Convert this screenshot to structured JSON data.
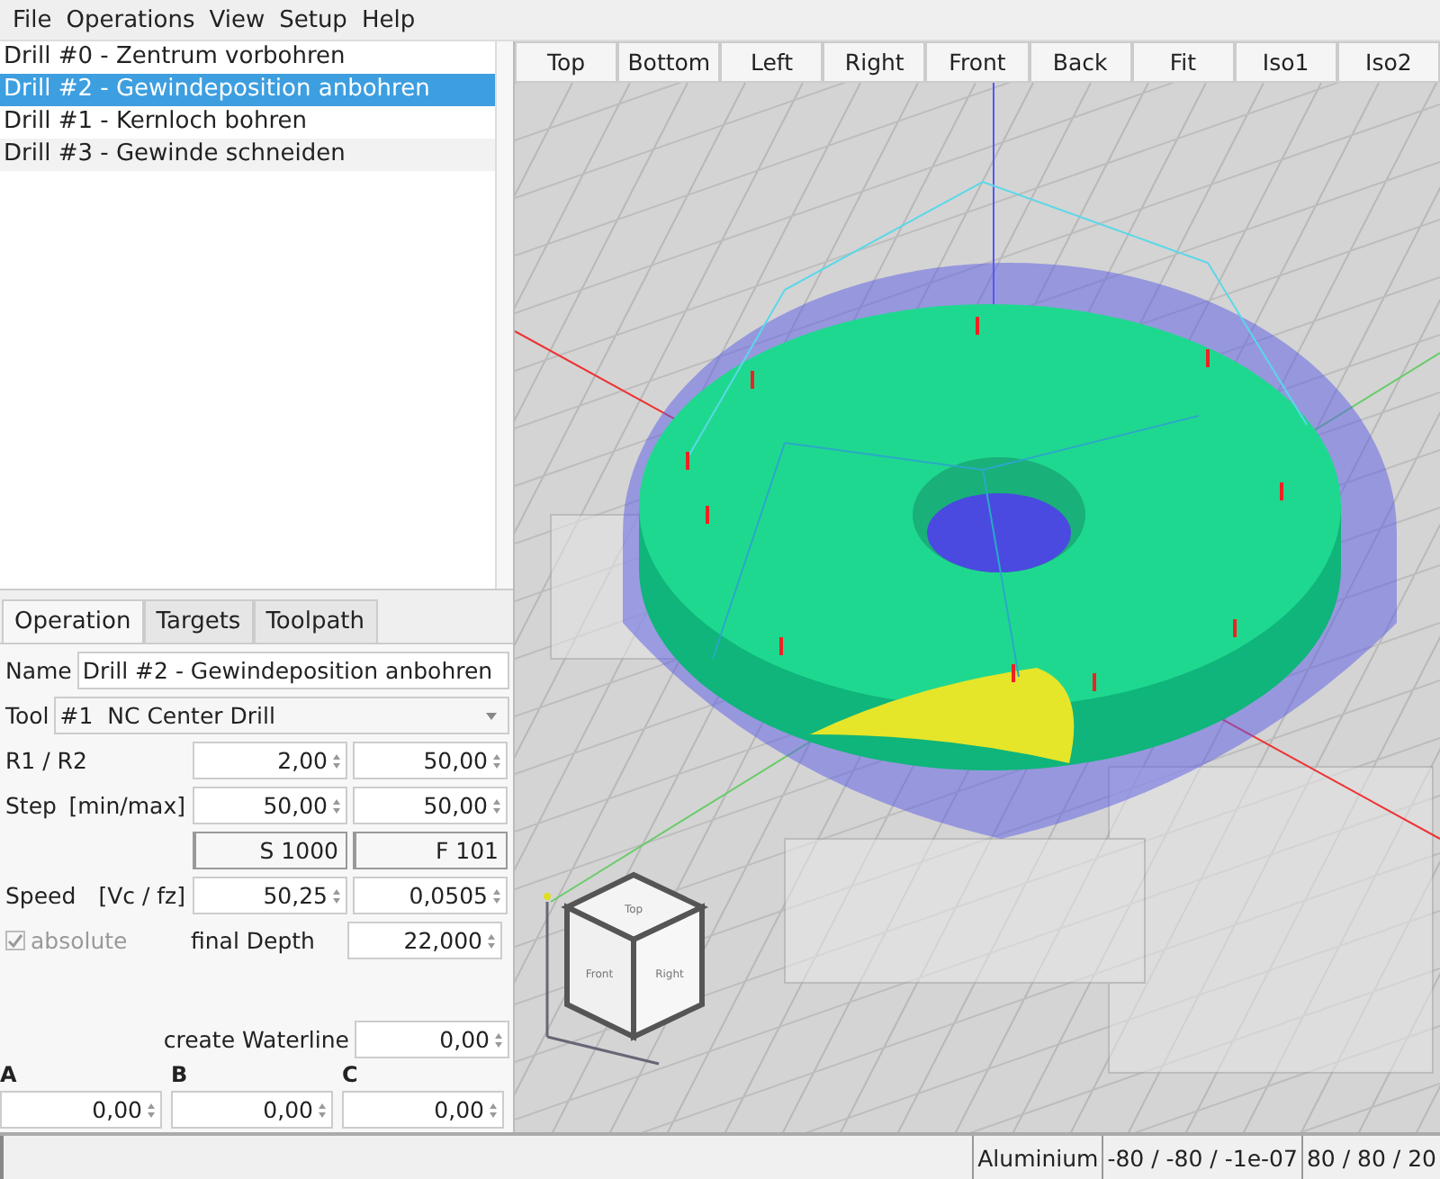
{
  "menu": [
    "File",
    "Operations",
    "View",
    "Setup",
    "Help"
  ],
  "operations": [
    {
      "label": "Drill #0 - Zentrum vorbohren",
      "selected": false
    },
    {
      "label": "Drill #2 - Gewindeposition anbohren",
      "selected": true
    },
    {
      "label": "Drill #1 - Kernloch bohren",
      "selected": false
    },
    {
      "label": "Drill #3 - Gewinde schneiden",
      "selected": false
    }
  ],
  "tabs": [
    {
      "label": "Operation",
      "selected": true
    },
    {
      "label": "Targets",
      "selected": false
    },
    {
      "label": "Toolpath",
      "selected": false
    }
  ],
  "form": {
    "name_label": "Name",
    "name_value": "Drill #2 - Gewindeposition anbohren",
    "tool_label": "Tool",
    "tool_value": "#1  NC Center Drill",
    "rows": [
      {
        "kind": "spin_pair",
        "label": "R1 / R2",
        "values": [
          "2,00",
          "50,00"
        ]
      },
      {
        "kind": "spin_pair",
        "label": "Step",
        "sublabel": "[min/max]",
        "values": [
          "50,00",
          "50,00"
        ]
      },
      {
        "kind": "readout_pair",
        "values": [
          "S 1000",
          "F 101"
        ]
      },
      {
        "kind": "spin_pair",
        "label": "Speed",
        "sublabel": "[Vc /  fz]",
        "values": [
          "50,25",
          "0,0505"
        ]
      },
      {
        "kind": "checkbox_spin",
        "label": "absolute",
        "checked": true,
        "disabled": true,
        "sublabel": "final Depth",
        "values": [
          "22,000"
        ]
      }
    ]
  },
  "waterline": {
    "label": "create Waterline",
    "value": "0,00"
  },
  "axes": [
    {
      "label": "A",
      "value": "0,00"
    },
    {
      "label": "B",
      "value": "0,00"
    },
    {
      "label": "C",
      "value": "0,00"
    }
  ],
  "view_buttons": [
    "Top",
    "Bottom",
    "Left",
    "Right",
    "Front",
    "Back",
    "Fit",
    "Iso1",
    "Iso2"
  ],
  "cube_labels": [
    "Top",
    "Front",
    "Right"
  ],
  "status_bar": [
    "Aluminium",
    "-80 / -80 / -1e-07",
    "80 / 80 / 20"
  ]
}
